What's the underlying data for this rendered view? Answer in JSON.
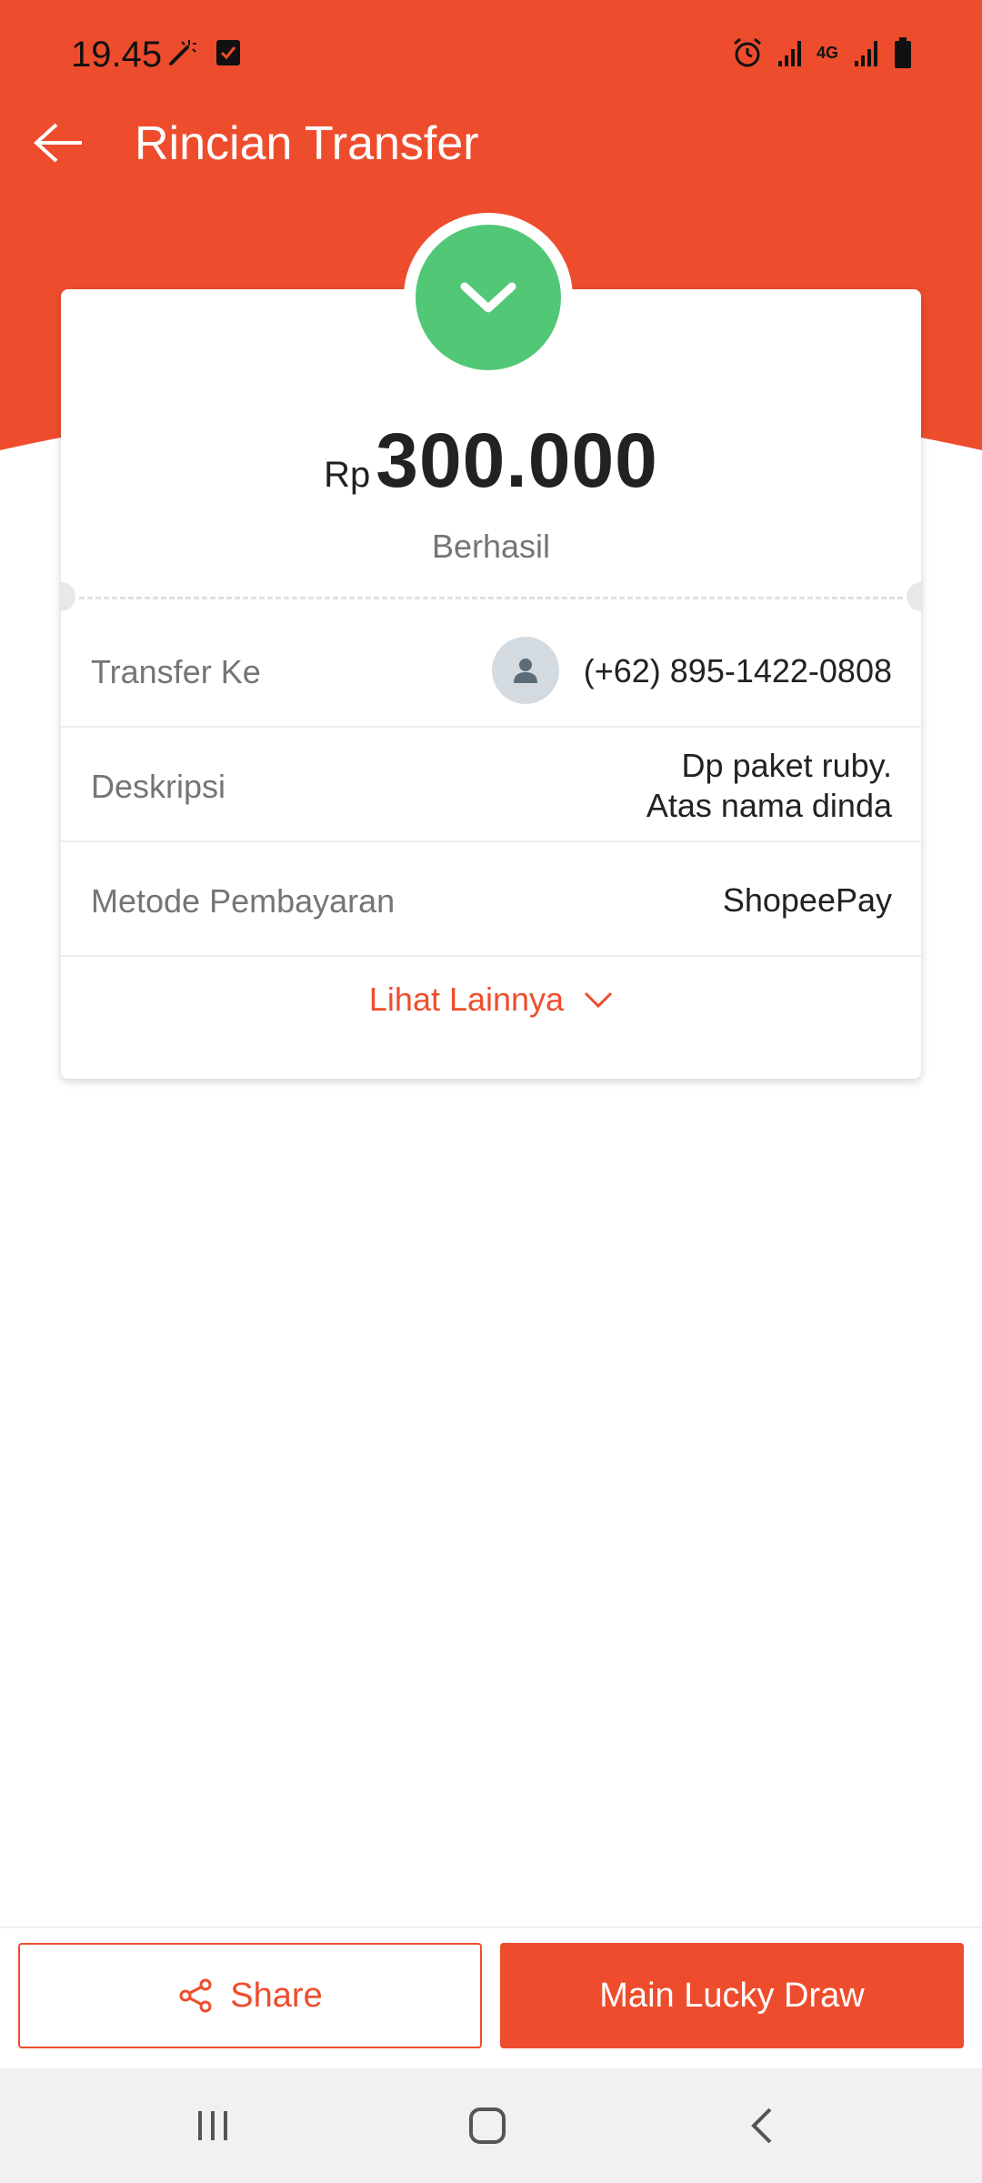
{
  "status_bar": {
    "time": "19.45",
    "left_icons": [
      "magic-wand-icon",
      "checkbox-icon"
    ],
    "right_icons": [
      "alarm-icon",
      "signal-icon",
      "4g-icon",
      "signal-icon",
      "battery-icon"
    ],
    "network_label": "4G"
  },
  "header": {
    "title": "Rincian Transfer",
    "back_icon": "arrow-left-icon",
    "color": "#ee4d2d"
  },
  "summary": {
    "currency": "Rp",
    "amount": "300.000",
    "status": "Berhasil",
    "status_icon": "chevron-down-icon",
    "status_color": "#52c776"
  },
  "details": [
    {
      "label": "Transfer Ke",
      "value": "(+62) 895-1422-0808",
      "icon": "user-avatar-icon"
    },
    {
      "label": "Deskripsi",
      "value_line1": "Dp paket ruby.",
      "value_line2": "Atas nama dinda"
    },
    {
      "label": "Metode Pembayaran",
      "value": "ShopeePay"
    }
  ],
  "see_more": {
    "label": "Lihat Lainnya",
    "icon": "chevron-down-icon"
  },
  "actions": {
    "share_label": "Share",
    "share_icon": "share-icon",
    "lucky_draw_label": "Main Lucky Draw"
  },
  "nav": [
    "recent-apps-icon",
    "home-icon",
    "back-icon"
  ]
}
